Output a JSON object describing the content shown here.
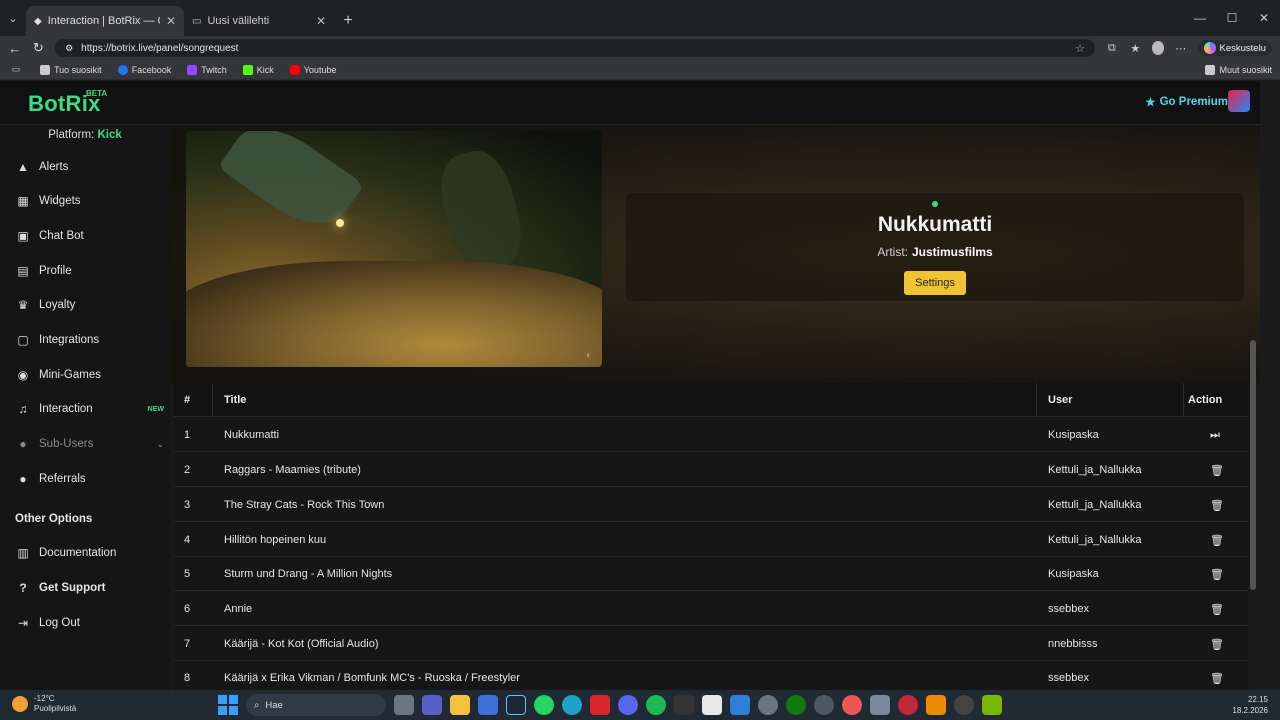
{
  "browser": {
    "tabs": [
      {
        "label": "Interaction | BotRix — Cloud"
      },
      {
        "label": "Uusi välilehti"
      }
    ],
    "url": "https://botrix.live/panel/songrequest",
    "chat_button": "Keskustelu",
    "bookmarks": [
      "Tuo suosikit",
      "Facebook",
      "Twitch",
      "Kick",
      "Youtube"
    ],
    "other_bookmarks": "Muut suosikit"
  },
  "app": {
    "brand": "BotRix",
    "beta": "BETA",
    "premium": "Go Premium",
    "platform_label": "Platform:",
    "platform_value": "Kick",
    "nav": [
      {
        "label": "Alerts",
        "icon": "warning-icon"
      },
      {
        "label": "Widgets",
        "icon": "grid-icon"
      },
      {
        "label": "Chat Bot",
        "icon": "robot-icon"
      },
      {
        "label": "Profile",
        "icon": "id-card-icon"
      },
      {
        "label": "Loyalty",
        "icon": "trophy-icon"
      },
      {
        "label": "Integrations",
        "icon": "plug-icon"
      },
      {
        "label": "Mini-Games",
        "icon": "gamepad-icon"
      },
      {
        "label": "Interaction",
        "icon": "music-icon",
        "badge": "NEW"
      },
      {
        "label": "Sub-Users",
        "icon": "users-icon"
      },
      {
        "label": "Referrals",
        "icon": "people-icon"
      }
    ],
    "other_options_title": "Other Options",
    "other_nav": [
      {
        "label": "Documentation",
        "icon": "book-icon"
      },
      {
        "label": "Get Support",
        "icon": "help-icon"
      },
      {
        "label": "Log Out",
        "icon": "logout-icon"
      }
    ]
  },
  "now_playing": {
    "title": "Nukkumatti",
    "artist_label": "Artist:",
    "artist": "Justimusfilms",
    "settings": "Settings"
  },
  "queue": {
    "headers": {
      "num": "#",
      "title": "Title",
      "user": "User",
      "action": "Action"
    },
    "rows": [
      {
        "num": "1",
        "title": "Nukkumatti",
        "user": "Kusipaska",
        "action": "skip"
      },
      {
        "num": "2",
        "title": "Raggars - Maamies (tribute)",
        "user": "Kettuli_ja_Nallukka",
        "action": "delete"
      },
      {
        "num": "3",
        "title": "The Stray Cats - Rock This Town",
        "user": "Kettuli_ja_Nallukka",
        "action": "delete"
      },
      {
        "num": "4",
        "title": "Hillitön hopeinen kuu",
        "user": "Kettuli_ja_Nallukka",
        "action": "delete"
      },
      {
        "num": "5",
        "title": "Sturm und Drang - A Million Nights",
        "user": "Kusipaska",
        "action": "delete"
      },
      {
        "num": "6",
        "title": "Annie",
        "user": "ssebbex",
        "action": "delete"
      },
      {
        "num": "7",
        "title": "Käärijä - Kot Kot (Official Audio)",
        "user": "nnebbisss",
        "action": "delete"
      },
      {
        "num": "8",
        "title": "Käärijä x Erika Vikman / Bomfunk MC's - Ruoska / Freestyler",
        "user": "ssebbex",
        "action": "delete"
      }
    ]
  },
  "taskbar": {
    "temp": "-12°C",
    "weather": "Puolipilvistä",
    "search": "Hae",
    "time": "22.15",
    "date": "18.2.2026"
  }
}
